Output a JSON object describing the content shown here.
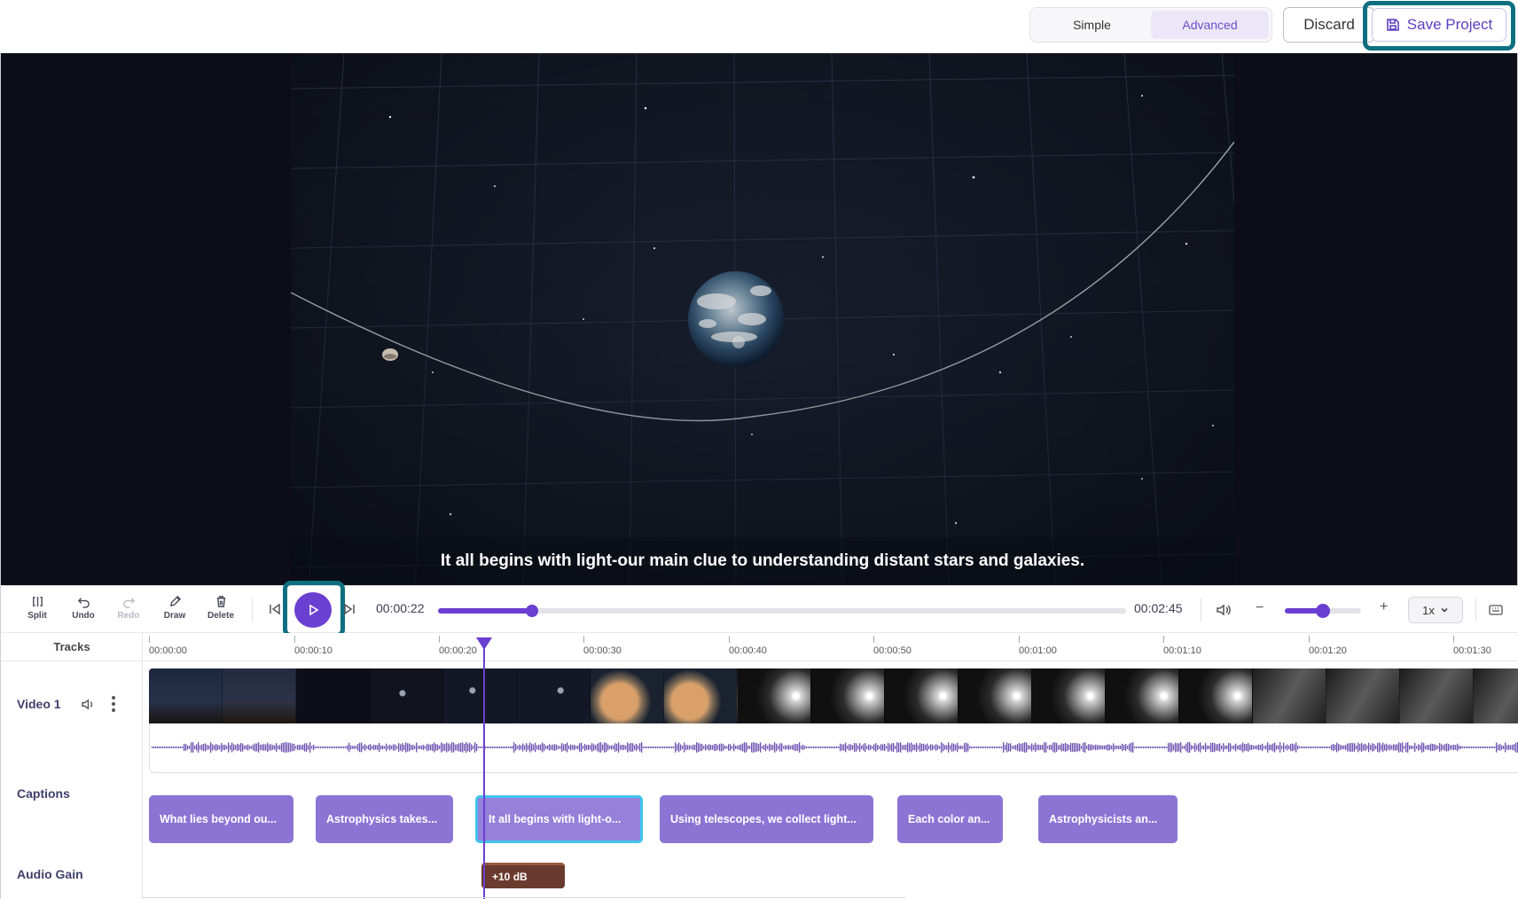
{
  "header": {
    "mode_simple": "Simple",
    "mode_advanced": "Advanced",
    "active_mode": "Advanced",
    "discard_label": "Discard",
    "save_label": "Save Project"
  },
  "preview": {
    "caption": "It all begins with light-our main clue to understanding distant stars and galaxies."
  },
  "toolbar": {
    "split": "Split",
    "undo": "Undo",
    "redo": "Redo",
    "draw": "Draw",
    "delete": "Delete",
    "current_time": "00:00:22",
    "total_time": "00:02:45",
    "playback_progress": 0.136,
    "zoom_level": 0.5,
    "speed": "1x"
  },
  "timeline": {
    "tracks_header": "Tracks",
    "ticks": [
      "00:00:00",
      "00:00:10",
      "00:00:20",
      "00:00:30",
      "00:00:40",
      "00:00:50",
      "00:01:00",
      "00:01:10",
      "00:01:20",
      "00:01:30"
    ],
    "track_video": "Video 1",
    "track_captions": "Captions",
    "track_gain": "Audio Gain",
    "captions": [
      "What lies beyond ou...",
      "Astrophysics takes...",
      "It all begins with light-o...",
      "Using telescopes, we collect light...",
      "Each color an...",
      "Astrophysicists an..."
    ],
    "gain_label": "+10 dB"
  },
  "colors": {
    "accent": "#6a3fd1",
    "highlight": "#0e6f80",
    "caption_clip": "#8c74d4",
    "selected_border": "#43c3ec",
    "gain_clip": "#6b3a2e"
  }
}
